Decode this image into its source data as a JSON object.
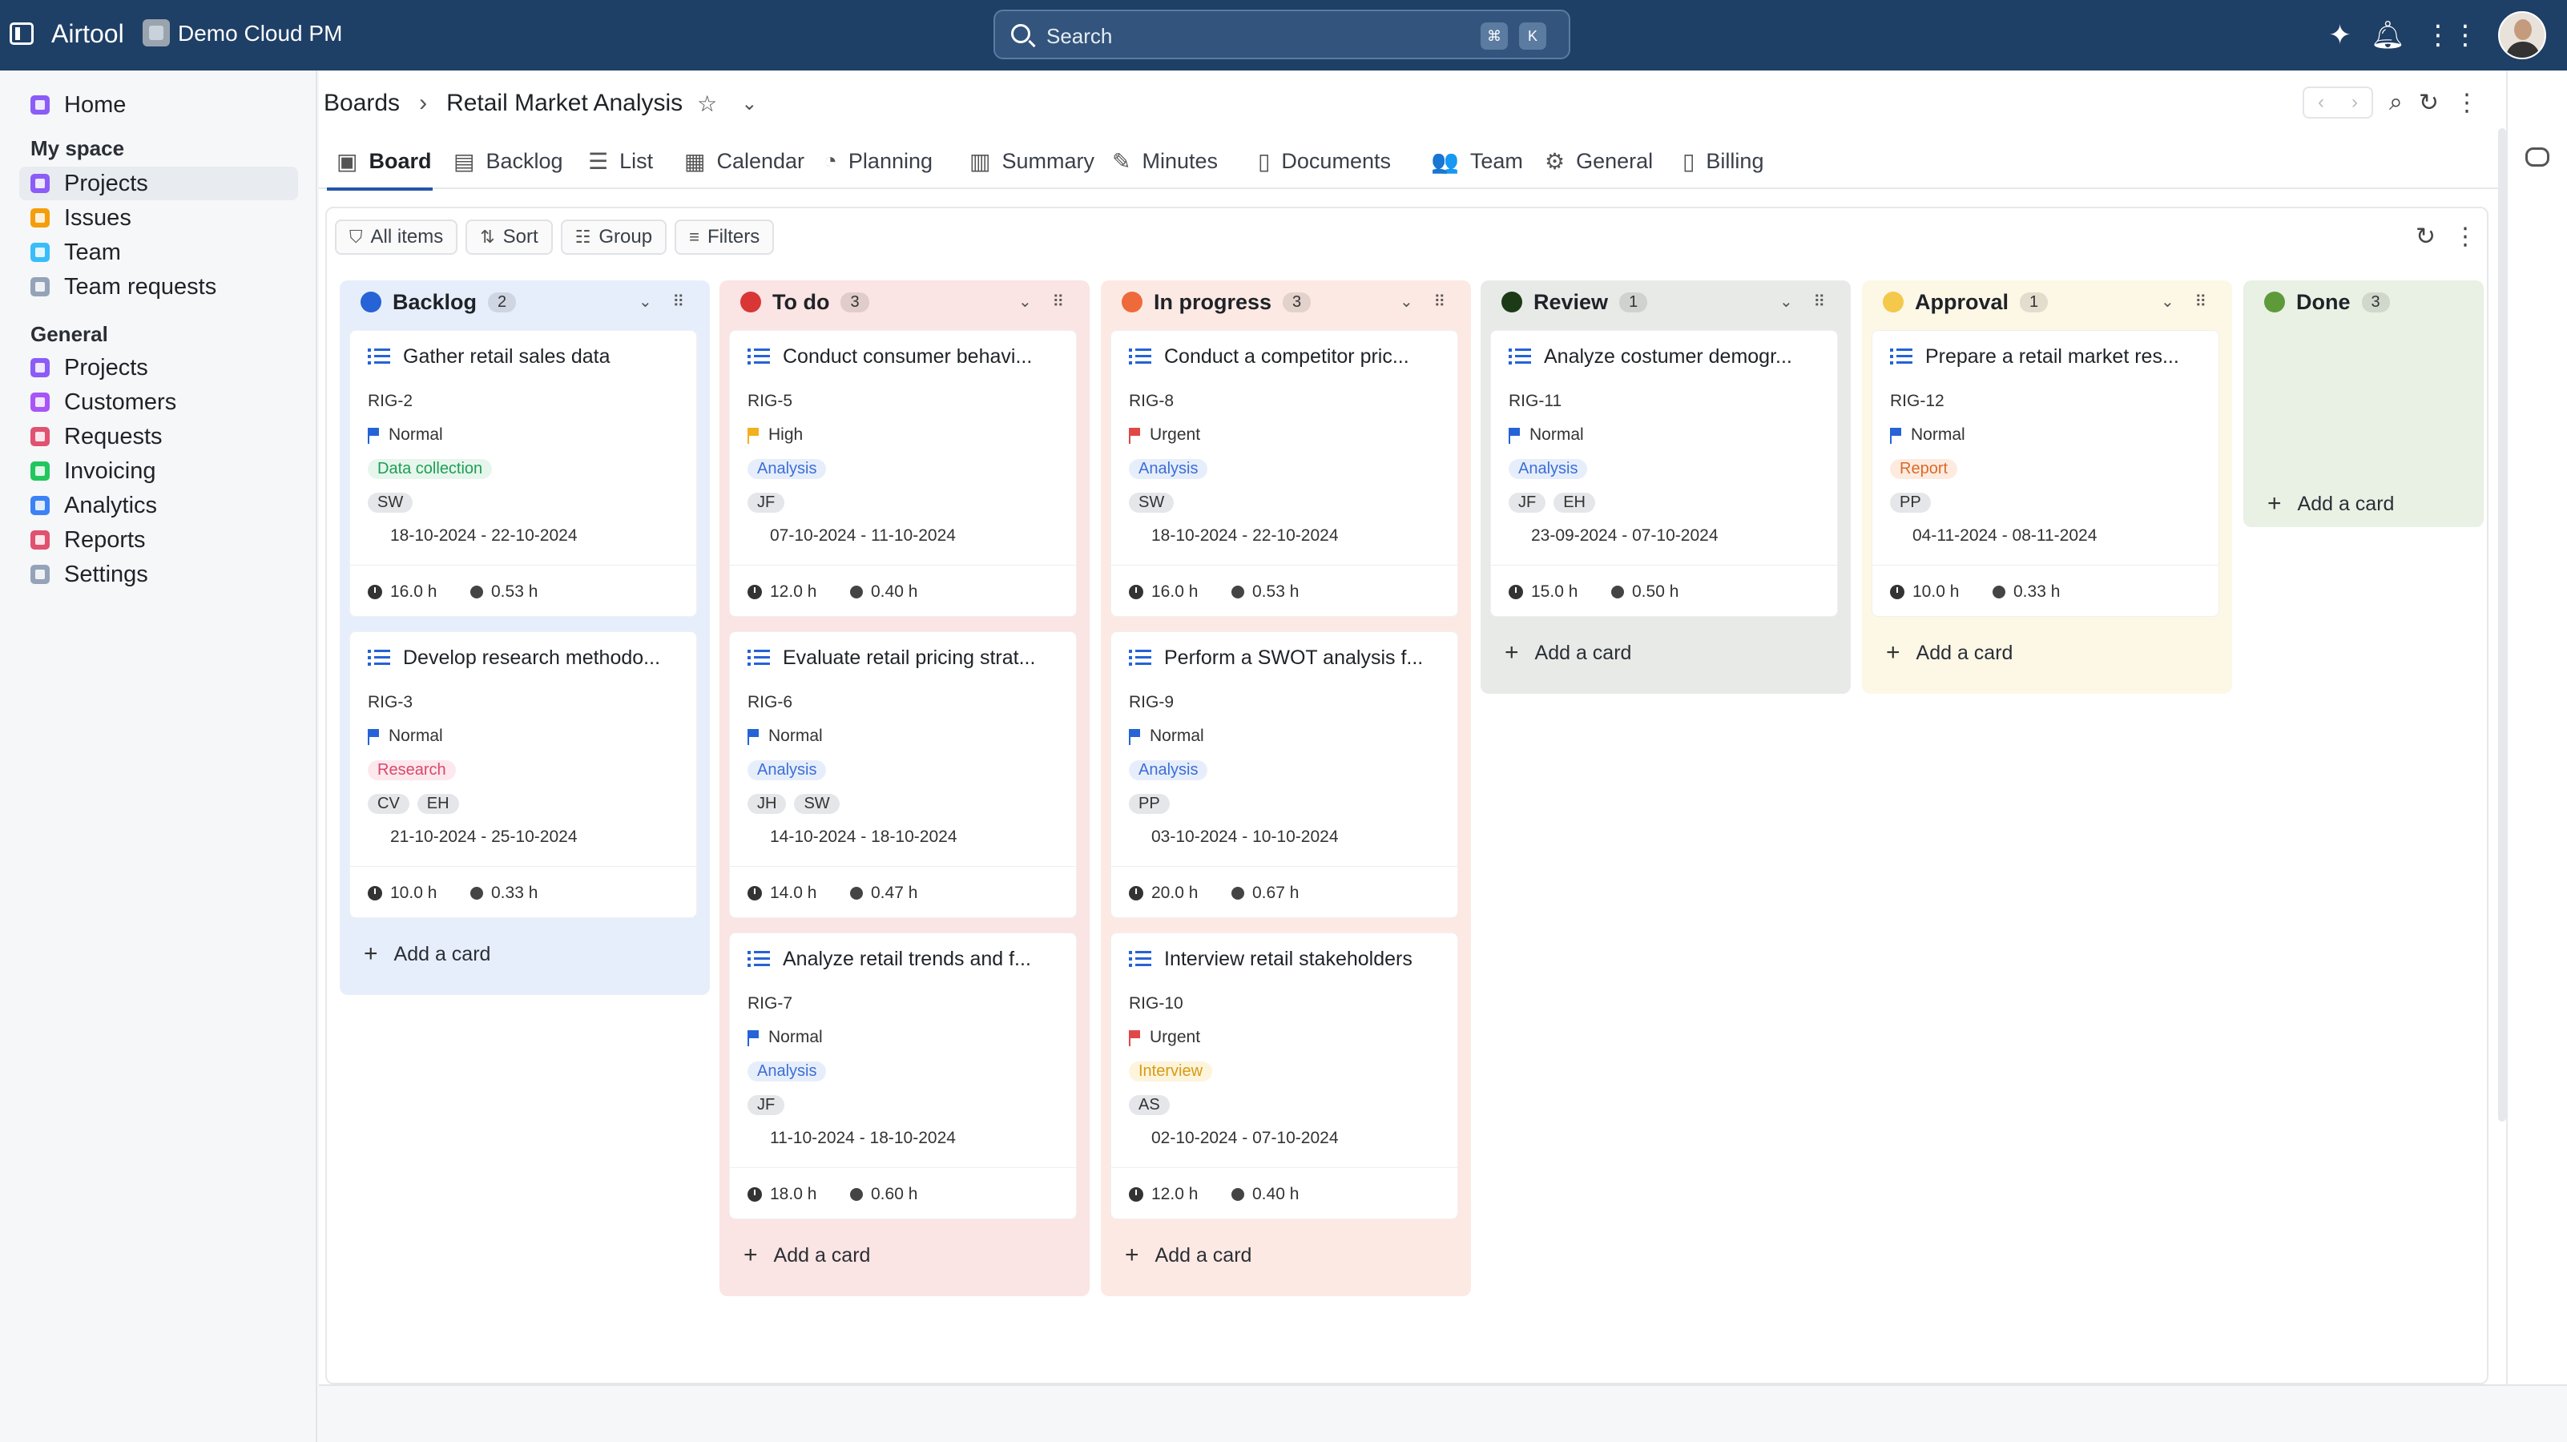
{
  "topbar": {
    "app_name": "Airtool",
    "workspace": "Demo Cloud PM",
    "search_placeholder": "Search",
    "shortcut_keys": [
      "⌘",
      "K"
    ]
  },
  "sidebar": {
    "home": "Home",
    "my_space_title": "My space",
    "my_space": [
      {
        "label": "Projects",
        "color": "#8b5cf6",
        "active": true
      },
      {
        "label": "Issues",
        "color": "#f59e0b"
      },
      {
        "label": "Team",
        "color": "#38bdf8"
      },
      {
        "label": "Team requests",
        "color": "#94a3b8"
      }
    ],
    "general_title": "General",
    "general": [
      {
        "label": "Projects",
        "color": "#8b5cf6"
      },
      {
        "label": "Customers",
        "color": "#a855f7"
      },
      {
        "label": "Requests",
        "color": "#e05270"
      },
      {
        "label": "Invoicing",
        "color": "#22c55e"
      },
      {
        "label": "Analytics",
        "color": "#3b82f6"
      },
      {
        "label": "Reports",
        "color": "#e05270"
      },
      {
        "label": "Settings",
        "color": "#94a3b8"
      }
    ]
  },
  "breadcrumb": {
    "root": "Boards",
    "current": "Retail Market Analysis"
  },
  "tabs": [
    {
      "label": "Board",
      "icon": "board-icon",
      "glyph": "▣",
      "active": true
    },
    {
      "label": "Backlog",
      "icon": "backlog-icon",
      "glyph": "▤"
    },
    {
      "label": "List",
      "icon": "list-icon",
      "glyph": "☰"
    },
    {
      "label": "Calendar",
      "icon": "calendar-icon",
      "glyph": "▦"
    },
    {
      "label": "Planning",
      "icon": "planning-icon",
      "glyph": "◔"
    },
    {
      "label": "Summary",
      "icon": "summary-icon",
      "glyph": "▥"
    },
    {
      "label": "Minutes",
      "icon": "minutes-icon",
      "glyph": "✎"
    },
    {
      "label": "Documents",
      "icon": "documents-icon",
      "glyph": "▯"
    },
    {
      "label": "Team",
      "icon": "team-icon",
      "glyph": "👥"
    },
    {
      "label": "General",
      "icon": "gear-icon",
      "glyph": "⚙"
    },
    {
      "label": "Billing",
      "icon": "billing-icon",
      "glyph": "▯"
    }
  ],
  "toolbar": {
    "all_items": "All items",
    "sort": "Sort",
    "group": "Group",
    "filters": "Filters"
  },
  "add_card_label": "Add a card",
  "columns": [
    {
      "title": "Backlog",
      "count": "2",
      "dot": "#2563d6",
      "bg": "#e7eefb",
      "cards": [
        {
          "title": "Gather retail sales data",
          "id": "RIG-2",
          "priority": "Normal",
          "prio_color": "#2563d6",
          "tag": "Data collection",
          "tag_color": "#1f9d55",
          "tag_bg": "#e6f6ec",
          "people": [
            "SW"
          ],
          "dates": "18-10-2024 - 22-10-2024",
          "estimate": "16.0 h",
          "spent": "0.53 h"
        },
        {
          "title": "Develop research methodo...",
          "id": "RIG-3",
          "priority": "Normal",
          "prio_color": "#2563d6",
          "tag": "Research",
          "tag_color": "#d9486a",
          "tag_bg": "#fde8ee",
          "people": [
            "CV",
            "EH"
          ],
          "dates": "21-10-2024 - 25-10-2024",
          "estimate": "10.0 h",
          "spent": "0.33 h"
        }
      ]
    },
    {
      "title": "To do",
      "count": "3",
      "dot": "#d93636",
      "bg": "#fbe4e4",
      "cards": [
        {
          "title": "Conduct consumer behavi...",
          "id": "RIG-5",
          "priority": "High",
          "prio_color": "#f2b01e",
          "tag": "Analysis",
          "tag_color": "#3b6fd6",
          "tag_bg": "#e7eefb",
          "people": [
            "JF"
          ],
          "dates": "07-10-2024 - 11-10-2024",
          "estimate": "12.0 h",
          "spent": "0.40 h"
        },
        {
          "title": "Evaluate retail pricing strat...",
          "id": "RIG-6",
          "priority": "Normal",
          "prio_color": "#2563d6",
          "tag": "Analysis",
          "tag_color": "#3b6fd6",
          "tag_bg": "#e7eefb",
          "people": [
            "JH",
            "SW"
          ],
          "dates": "14-10-2024 - 18-10-2024",
          "estimate": "14.0 h",
          "spent": "0.47 h"
        },
        {
          "title": "Analyze retail trends and f...",
          "id": "RIG-7",
          "priority": "Normal",
          "prio_color": "#2563d6",
          "tag": "Analysis",
          "tag_color": "#3b6fd6",
          "tag_bg": "#e7eefb",
          "people": [
            "JF"
          ],
          "dates": "11-10-2024 - 18-10-2024",
          "estimate": "18.0 h",
          "spent": "0.60 h"
        }
      ]
    },
    {
      "title": "In progress",
      "count": "3",
      "dot": "#ef6a3a",
      "bg": "#fde9e4",
      "cards": [
        {
          "title": "Conduct a competitor pric...",
          "id": "RIG-8",
          "priority": "Urgent",
          "prio_color": "#e04848",
          "tag": "Analysis",
          "tag_color": "#3b6fd6",
          "tag_bg": "#e7eefb",
          "people": [
            "SW"
          ],
          "dates": "18-10-2024 - 22-10-2024",
          "estimate": "16.0 h",
          "spent": "0.53 h"
        },
        {
          "title": "Perform a SWOT analysis f...",
          "id": "RIG-9",
          "priority": "Normal",
          "prio_color": "#2563d6",
          "tag": "Analysis",
          "tag_color": "#3b6fd6",
          "tag_bg": "#e7eefb",
          "people": [
            "PP"
          ],
          "dates": "03-10-2024 - 10-10-2024",
          "estimate": "20.0 h",
          "spent": "0.67 h"
        },
        {
          "title": "Interview retail stakeholders",
          "id": "RIG-10",
          "priority": "Urgent",
          "prio_color": "#e04848",
          "tag": "Interview",
          "tag_color": "#d99a12",
          "tag_bg": "#fdf4dc",
          "people": [
            "AS"
          ],
          "dates": "02-10-2024 - 07-10-2024",
          "estimate": "12.0 h",
          "spent": "0.40 h"
        }
      ]
    },
    {
      "title": "Review",
      "count": "1",
      "dot": "#1c3a16",
      "bg": "#e8eae8",
      "cards": [
        {
          "title": "Analyze costumer demogr...",
          "id": "RIG-11",
          "priority": "Normal",
          "prio_color": "#2563d6",
          "tag": "Analysis",
          "tag_color": "#3b6fd6",
          "tag_bg": "#e7eefb",
          "people": [
            "JF",
            "EH"
          ],
          "dates": "23-09-2024 - 07-10-2024",
          "estimate": "15.0 h",
          "spent": "0.50 h"
        }
      ]
    },
    {
      "title": "Approval",
      "count": "1",
      "dot": "#f3c84b",
      "bg": "#fdf7e6",
      "cards": [
        {
          "title": "Prepare a retail market res...",
          "id": "RIG-12",
          "priority": "Normal",
          "prio_color": "#2563d6",
          "tag": "Report",
          "tag_color": "#d96a2a",
          "tag_bg": "#fdebe0",
          "people": [
            "PP"
          ],
          "dates": "04-11-2024 - 08-11-2024",
          "estimate": "10.0 h",
          "spent": "0.33 h"
        }
      ]
    },
    {
      "title": "Done",
      "count": "3",
      "dot": "#5f9a3a",
      "bg": "#e8f1e4",
      "cards": []
    }
  ]
}
